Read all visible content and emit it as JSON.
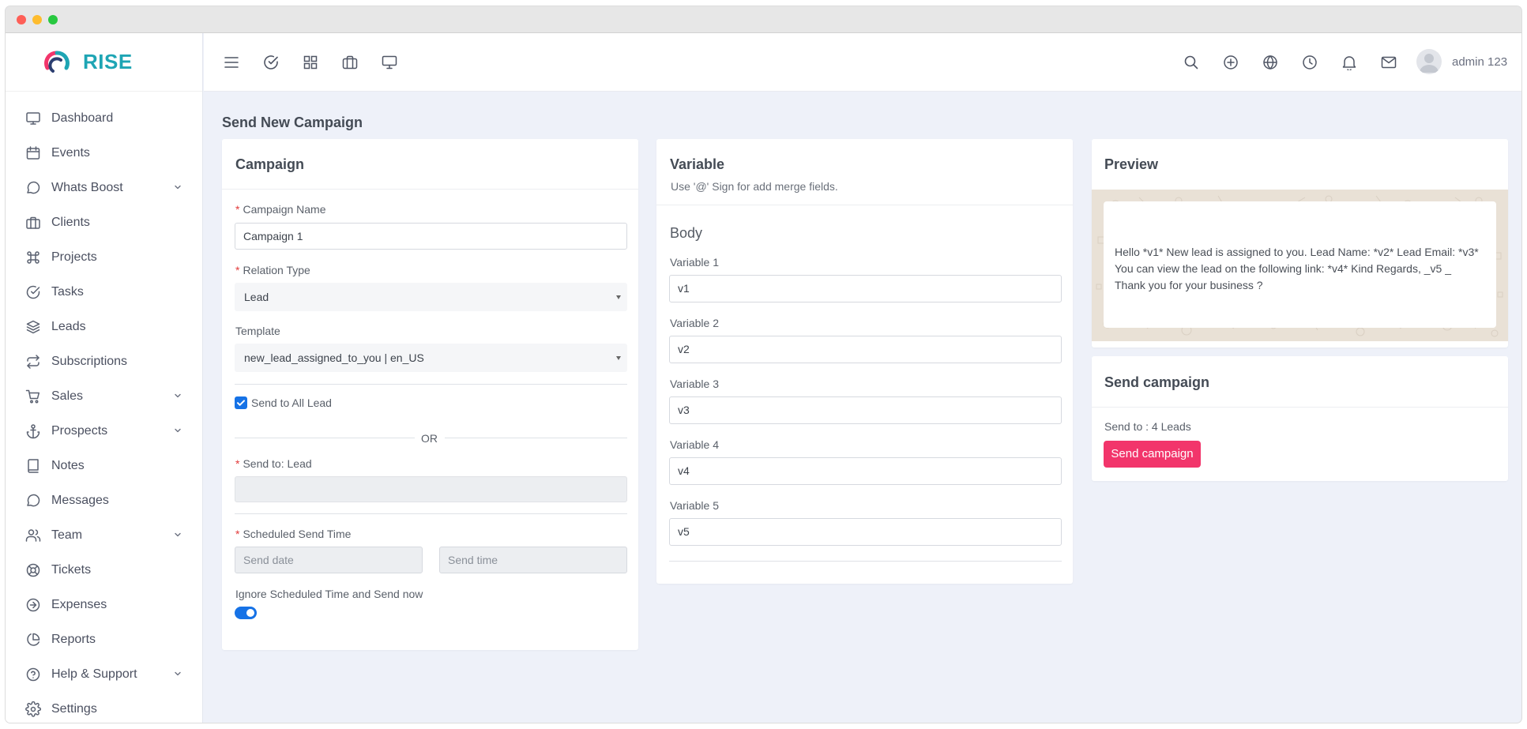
{
  "app": {
    "brand": "RISE"
  },
  "sidebar": {
    "items": [
      {
        "label": "Dashboard",
        "icon": "monitor-icon",
        "expandable": false
      },
      {
        "label": "Events",
        "icon": "calendar-icon",
        "expandable": false
      },
      {
        "label": "Whats Boost",
        "icon": "chat-bubble-icon",
        "expandable": true
      },
      {
        "label": "Clients",
        "icon": "briefcase-icon",
        "expandable": false
      },
      {
        "label": "Projects",
        "icon": "command-icon",
        "expandable": false
      },
      {
        "label": "Tasks",
        "icon": "check-circle-icon",
        "expandable": false
      },
      {
        "label": "Leads",
        "icon": "layers-icon",
        "expandable": false
      },
      {
        "label": "Subscriptions",
        "icon": "repeat-icon",
        "expandable": false
      },
      {
        "label": "Sales",
        "icon": "cart-icon",
        "expandable": true
      },
      {
        "label": "Prospects",
        "icon": "anchor-icon",
        "expandable": true
      },
      {
        "label": "Notes",
        "icon": "book-icon",
        "expandable": false
      },
      {
        "label": "Messages",
        "icon": "message-icon",
        "expandable": false
      },
      {
        "label": "Team",
        "icon": "users-icon",
        "expandable": true
      },
      {
        "label": "Tickets",
        "icon": "life-buoy-icon",
        "expandable": false
      },
      {
        "label": "Expenses",
        "icon": "arrow-circle-icon",
        "expandable": false
      },
      {
        "label": "Reports",
        "icon": "pie-chart-icon",
        "expandable": false
      },
      {
        "label": "Help & Support",
        "icon": "help-circle-icon",
        "expandable": true
      },
      {
        "label": "Settings",
        "icon": "gear-icon",
        "expandable": false
      }
    ]
  },
  "topbar": {
    "user_name": "admin 123"
  },
  "page": {
    "title": "Send New Campaign"
  },
  "campaign": {
    "title": "Campaign",
    "name_label": "Campaign Name",
    "name_value": "Campaign 1",
    "relation_label": "Relation Type",
    "relation_value": "Lead",
    "template_label": "Template",
    "template_value": "new_lead_assigned_to_you | en_US",
    "send_all_label": "Send to All Lead",
    "or_text": "OR",
    "send_to_label": "Send to: Lead",
    "scheduled_label": "Scheduled Send Time",
    "date_placeholder": "Send date",
    "time_placeholder": "Send time",
    "ignore_label": "Ignore Scheduled Time and Send now"
  },
  "variable": {
    "title": "Variable",
    "hint": "Use '@' Sign for add merge fields.",
    "section": "Body",
    "items": [
      {
        "label": "Variable 1",
        "value": "v1"
      },
      {
        "label": "Variable 2",
        "value": "v2"
      },
      {
        "label": "Variable 3",
        "value": "v3"
      },
      {
        "label": "Variable 4",
        "value": "v4"
      },
      {
        "label": "Variable 5",
        "value": "v5"
      }
    ]
  },
  "preview": {
    "title": "Preview",
    "line1": "Hello *v1* New lead is assigned to you. Lead Name: *v2* Lead Email: *v3*",
    "line2": "You can view the lead on the following link: *v4* Kind Regards, _v5 _",
    "line3": "Thank you for your business ?"
  },
  "send": {
    "title": "Send campaign",
    "summary": "Send to : 4 Leads",
    "button": "Send campaign"
  },
  "colors": {
    "brand": "#1ea5b4",
    "accent": "#1672e6",
    "send_button": "#f2356b",
    "background": "#eef1f9"
  }
}
